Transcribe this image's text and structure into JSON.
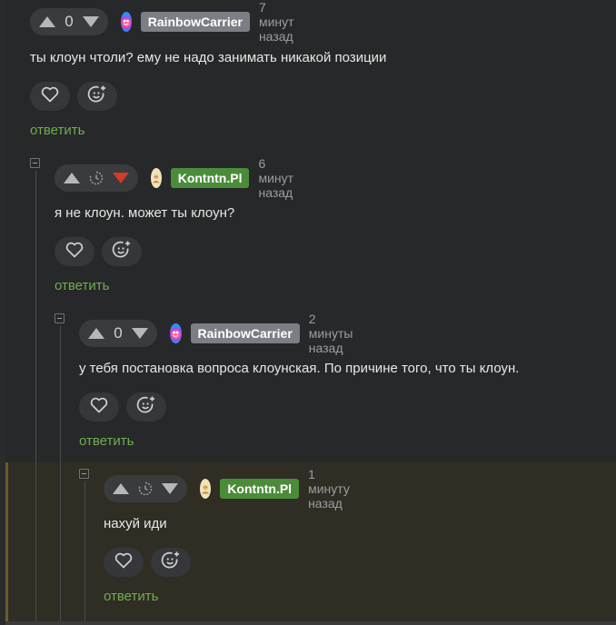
{
  "comments": [
    {
      "score": "0",
      "author": "RainbowCarrier",
      "time": "7 минут назад",
      "text": "ты клоун чтоли? ему не надо занимать никакой позиции",
      "reply_label": "ответить"
    },
    {
      "score": "",
      "author": "Kontntn.Pl",
      "time": "6 минут назад",
      "text": "я не клоун. может ты клоун?",
      "reply_label": "ответить"
    },
    {
      "score": "0",
      "author": "RainbowCarrier",
      "time": "2 минуты назад",
      "text": "у тебя постановка вопроса клоунская. По причине того, что ты клоун.",
      "reply_label": "ответить"
    },
    {
      "score": "",
      "author": "Kontntn.Pl",
      "time": "1 минуту назад",
      "text": "нахуй иди",
      "reply_label": "ответить"
    }
  ],
  "colors": {
    "reply_link": "#6fae4f",
    "downvote_active": "#d43b2a",
    "nick_gray": "#7b7e84",
    "nick_green": "#4b8c3a",
    "highlight_bg": "#302d24"
  },
  "icons": [
    "upvote-icon",
    "downvote-icon",
    "timer-icon",
    "heart-icon",
    "add-reaction-icon",
    "collapse-icon"
  ]
}
